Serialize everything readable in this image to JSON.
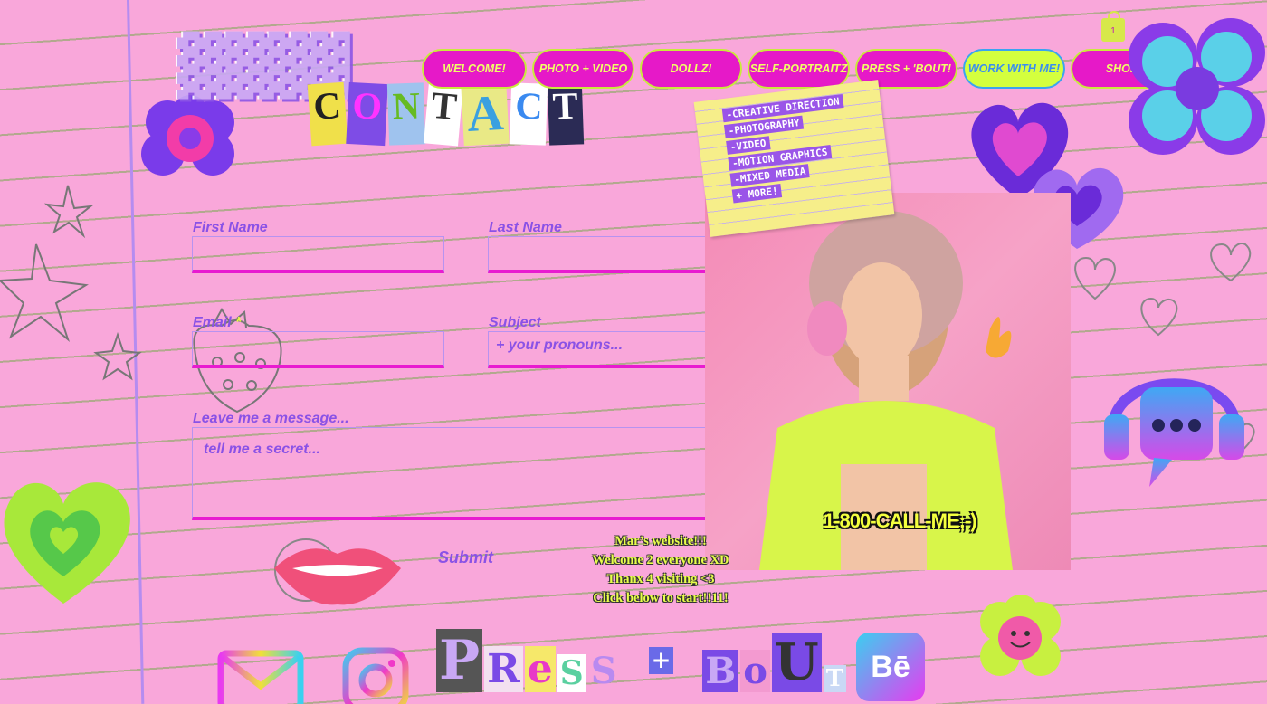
{
  "cart": {
    "count": "1"
  },
  "nav": {
    "items": [
      {
        "label": "WELCOME!",
        "width": 116
      },
      {
        "label": "PHOTO + VIDEO",
        "width": 113
      },
      {
        "label": "DOLLZ!",
        "width": 113
      },
      {
        "label": "SELF-PORTRAITZ",
        "width": 113
      },
      {
        "label": "PRESS + 'BOUT!",
        "width": 113
      },
      {
        "label": "WORK WITH ME!",
        "width": 113,
        "active": true
      },
      {
        "label": "SHOP",
        "width": 113
      }
    ]
  },
  "header": {
    "title_letters": [
      "C",
      "O",
      "N",
      "T",
      "A",
      "C",
      "T"
    ]
  },
  "form": {
    "first_name_label": "First Name",
    "last_name_label": "Last Name",
    "email_label": "Email",
    "email_required": "*",
    "subject_label": "Subject",
    "subject_placeholder": "+ your pronouns...",
    "message_label": "Leave me a message...",
    "message_placeholder": "tell me a secret...",
    "submit_label": "Submit"
  },
  "note": {
    "services": [
      "-CREATIVE DIRECTION",
      "-PHOTOGRAPHY",
      "-VIDEO",
      "-MOTION GRAPHICS",
      "-MIXED MEDIA",
      "+ MORE!"
    ]
  },
  "photo": {
    "phone_text": "1-800-CALL-ME;-)"
  },
  "welcome": {
    "lines": [
      "Mar’s website!!!",
      "Welcome 2 everyone XD",
      "Thanx 4 visiting <3",
      "Click below to start!!11!"
    ]
  },
  "footer": {
    "press_letters": [
      "P",
      "R",
      "e",
      "S",
      "S",
      "+",
      "B",
      "o",
      "U",
      "T"
    ],
    "behance_label": "Bē"
  },
  "colors": {
    "background": "#f9a7da",
    "nav_bg": "#e619c8",
    "nav_text": "#f1ff66",
    "accent_purple": "#8a52e6",
    "accent_lime": "#d4ff3e"
  }
}
